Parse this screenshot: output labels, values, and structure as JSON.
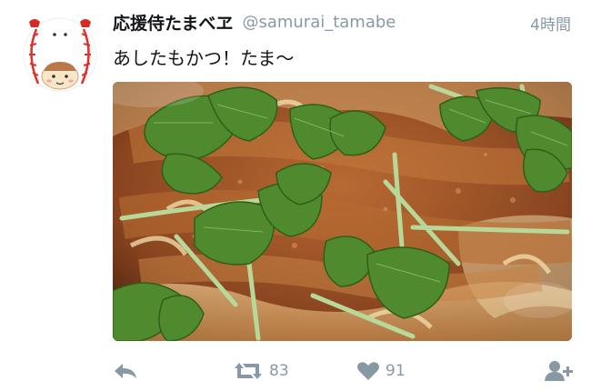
{
  "tweet": {
    "display_name": "応援侍たまべヱ",
    "handle": "@samurai_tamabe",
    "timestamp": "4時間",
    "text": "あしたもかつ！たま〜"
  },
  "actions": {
    "retweet_count": "83",
    "like_count": "91"
  },
  "icons": {
    "reply": "reply-icon",
    "retweet": "retweet-icon",
    "like": "heart-icon",
    "follow": "follow-icon"
  },
  "colors": {
    "icon_gray": "#8899a6",
    "name_text": "#14171a"
  }
}
